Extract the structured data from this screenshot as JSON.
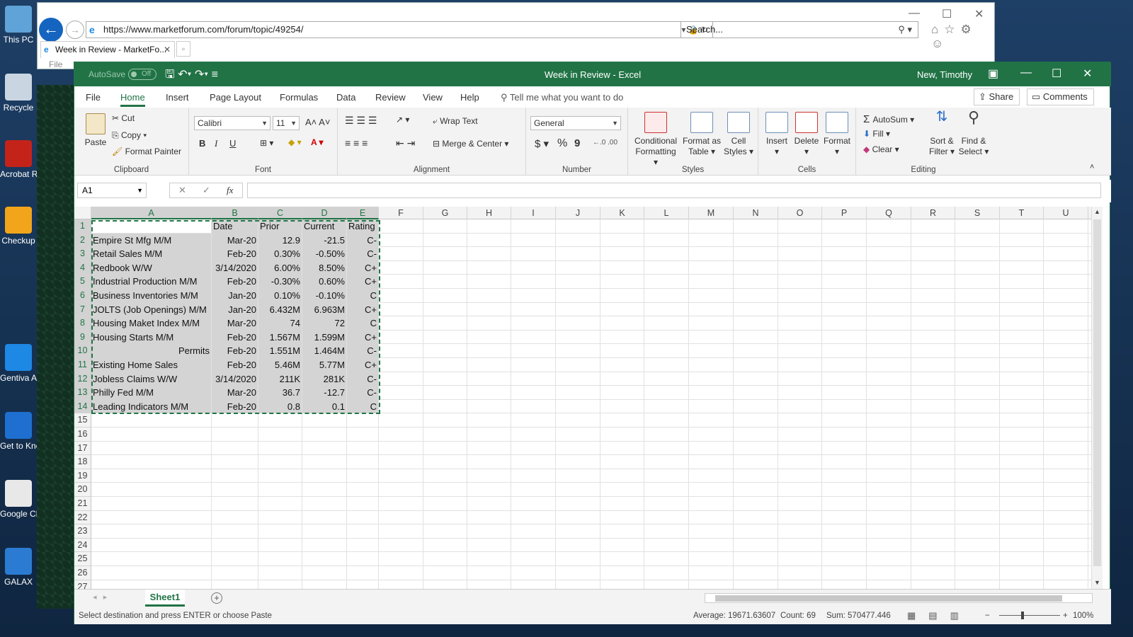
{
  "desktop": {
    "icons": [
      {
        "label": "This PC",
        "color": "#5fa3d8"
      },
      {
        "label": "Recycle",
        "color": "#c9d6e2"
      },
      {
        "label": "Acrobat Reader D",
        "color": "#c4231a"
      },
      {
        "label": "Checkup",
        "color": "#f2a51a"
      },
      {
        "label": "Gentiva Apps Lo",
        "color": "#1e88e5"
      },
      {
        "label": "Get to Know Windows",
        "color": "#1e6fd0"
      },
      {
        "label": "Google Chrome",
        "color": "#e8e8e8"
      },
      {
        "label": "GALAX",
        "color": "#2b7bd3"
      }
    ]
  },
  "browser": {
    "url": "https://www.marketforum.com/forum/topic/49254/",
    "search_placeholder": "Search...",
    "tab_title": "Week in Review - MarketFo...",
    "menu_file": "File"
  },
  "excel": {
    "title": "Week in Review  -  Excel",
    "user": "New, Timothy",
    "autosave": "AutoSave",
    "autosave_state": "Off",
    "tabs": [
      "File",
      "Home",
      "Insert",
      "Page Layout",
      "Formulas",
      "Data",
      "Review",
      "View",
      "Help"
    ],
    "active_tab": "Home",
    "tell_me": "Tell me what you want to do",
    "share": "Share",
    "comments": "Comments",
    "ribbon": {
      "clipboard": {
        "label": "Clipboard",
        "paste": "Paste",
        "cut": "Cut",
        "copy": "Copy",
        "format_painter": "Format Painter"
      },
      "font": {
        "label": "Font",
        "name": "Calibri",
        "size": "11",
        "bold": "B",
        "italic": "I",
        "underline": "U"
      },
      "alignment": {
        "label": "Alignment",
        "wrap": "Wrap Text",
        "merge": "Merge & Center"
      },
      "number": {
        "label": "Number",
        "format": "General",
        "currency": "$",
        "percent": "%",
        "comma": "9"
      },
      "styles": {
        "label": "Styles",
        "conditional": "Conditional",
        "conditional2": "Formatting",
        "format_table": "Format as",
        "format_table2": "Table",
        "cell_styles": "Cell",
        "cell_styles2": "Styles"
      },
      "cells": {
        "label": "Cells",
        "insert": "Insert",
        "delete": "Delete",
        "format": "Format"
      },
      "editing": {
        "label": "Editing",
        "autosum": "AutoSum",
        "fill": "Fill",
        "clear": "Clear",
        "sort": "Sort &",
        "sort2": "Filter",
        "find": "Find &",
        "find2": "Select"
      }
    },
    "name_box": "A1",
    "fx": "fx",
    "columns": [
      "A",
      "B",
      "C",
      "D",
      "E",
      "F",
      "G",
      "H",
      "I",
      "J",
      "K",
      "L",
      "M",
      "N",
      "O",
      "P",
      "Q",
      "R",
      "S",
      "T",
      "U"
    ],
    "rows": [
      [
        "",
        "Date",
        "Prior",
        "Current",
        "Rating"
      ],
      [
        "Empire St Mfg M/M",
        "Mar-20",
        "12.9",
        "-21.5",
        "C-"
      ],
      [
        "Retail Sales M/M",
        "Feb-20",
        "0.30%",
        "-0.50%",
        "C-"
      ],
      [
        "Redbook W/W",
        "3/14/2020",
        "6.00%",
        "8.50%",
        "C+"
      ],
      [
        "Industrial Production M/M",
        "Feb-20",
        "-0.30%",
        "0.60%",
        "C+"
      ],
      [
        "Business Inventories M/M",
        "Jan-20",
        "0.10%",
        "-0.10%",
        "C"
      ],
      [
        "JOLTS (Job Openings) M/M",
        "Jan-20",
        "6.432M",
        "6.963M",
        "C+"
      ],
      [
        "Housing Maket Index M/M",
        "Mar-20",
        "74",
        "72",
        "C"
      ],
      [
        "Housing Starts  M/M",
        "Feb-20",
        "1.567M",
        "1.599M",
        "C+"
      ],
      [
        "Permits",
        "Feb-20",
        "1.551M",
        "1.464M",
        "C-"
      ],
      [
        "Existing Home Sales",
        "Feb-20",
        "5.46M",
        "5.77M",
        "C+"
      ],
      [
        "Jobless Claims W/W",
        "3/14/2020",
        "211K",
        "281K",
        "C-"
      ],
      [
        "Philly Fed  M/M",
        "Mar-20",
        "36.7",
        "-12.7",
        "C-"
      ],
      [
        "Leading Indicators M/M",
        "Feb-20",
        "0.8",
        "0.1",
        "C"
      ]
    ],
    "row_numbers": [
      "1",
      "2",
      "3",
      "4",
      "5",
      "6",
      "7",
      "8",
      "9",
      "10",
      "11",
      "12",
      "13",
      "14",
      "15",
      "16",
      "17",
      "18",
      "19",
      "20",
      "21",
      "22",
      "23",
      "24",
      "25",
      "26",
      "27"
    ],
    "sheet": "Sheet1",
    "status": {
      "message": "Select destination and press ENTER or choose Paste",
      "average": "Average: 19671.63607",
      "count": "Count: 69",
      "sum": "Sum: 570477.446",
      "zoom": "100%"
    }
  }
}
